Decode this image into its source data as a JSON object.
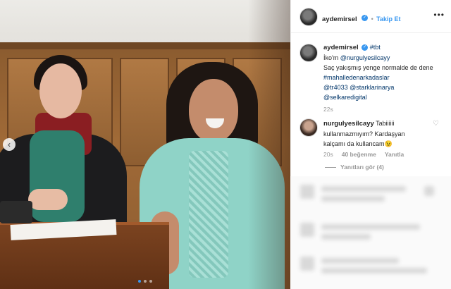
{
  "post": {
    "username": "aydemirsel",
    "follow_label": "Takip Et",
    "more_label": "•••",
    "caption": {
      "hashtag_tbt": "#tbt",
      "line2_prefix": "İko'm ",
      "mention_nurgul": "@nurgulyesilcayy",
      "line3": "Saç yakışmış yenge normalde de dene",
      "hashtag_mahalle": "#mahalledenarkadaslar",
      "mention_tr": "@tr4033",
      "mention_stark": "@starklarinarya",
      "mention_selkare": "@selkaredigital"
    },
    "caption_time": "22s"
  },
  "comment": {
    "username": "nurgulyesilcayy",
    "text_line1": "Tabiiiiii",
    "text_line2": "kullanmazmıyım? Kardaşyan",
    "text_line3": "kalçamı da kullancam😉",
    "time": "20s",
    "likes": "40 beğenme",
    "reply_label": "Yanıtla",
    "view_replies": "Yanıtları gör (4)"
  },
  "photo": {
    "prev_arrow": "‹",
    "carousel_dots": 3,
    "active_dot": 1
  },
  "colors": {
    "accent": "#3897f0",
    "text": "#262626",
    "muted": "#999999"
  }
}
